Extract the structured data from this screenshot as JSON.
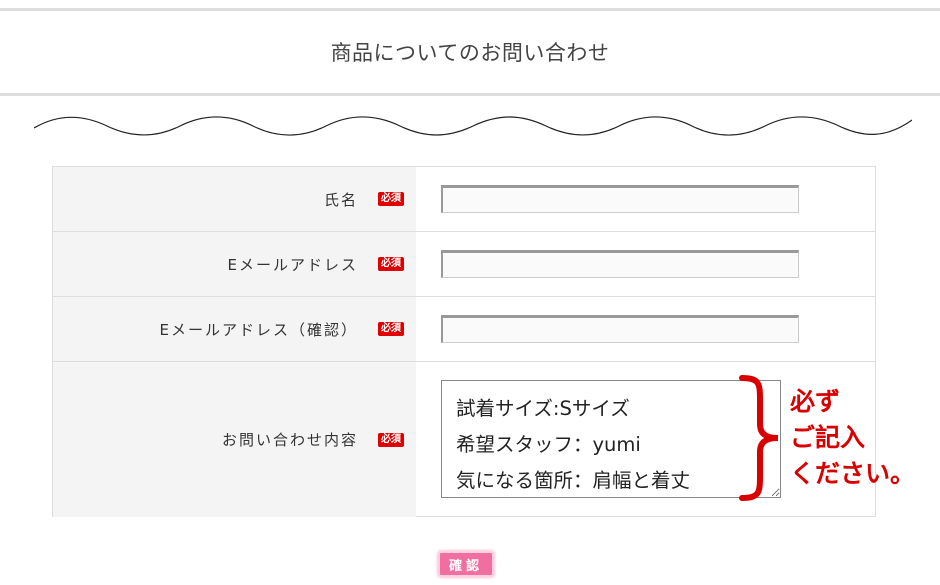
{
  "header": {
    "title": "商品についてのお問い合わせ"
  },
  "form": {
    "required_label": "必須",
    "rows": [
      {
        "label": "氏名",
        "value": ""
      },
      {
        "label": "Eメールアドレス",
        "value": ""
      },
      {
        "label": "Eメールアドレス（確認）",
        "value": ""
      },
      {
        "label": "お問い合わせ内容",
        "value": "試着サイズ:Sサイズ\n希望スタッフ：yumi\n気になる箇所：肩幅と着丈"
      }
    ]
  },
  "annotation": {
    "lines": [
      "必ず",
      "ご記入",
      "ください。"
    ],
    "color": "#d80000"
  },
  "confirm_button": {
    "label": "確認"
  }
}
